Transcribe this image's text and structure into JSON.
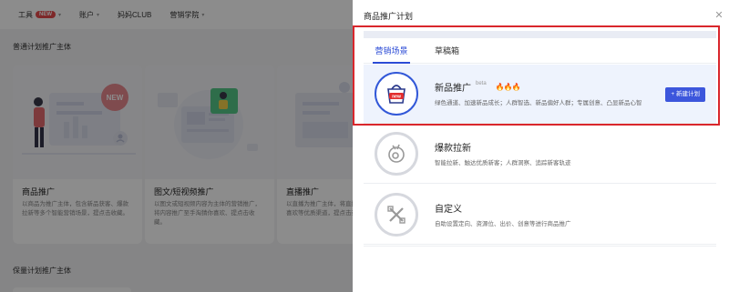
{
  "background": {
    "nav": [
      {
        "label": "工具",
        "badge": "NEW"
      },
      {
        "label": "账户"
      },
      {
        "label": "妈妈CLUB"
      },
      {
        "label": "营销学院"
      }
    ],
    "section_title": "普通计划推广主体",
    "section2_title": "保量计划推广主体",
    "cards": [
      {
        "title": "商品推广",
        "desc": "以商品为推广主体，包含新品获客、爆款拉新等多个智能营销场景，提点击收藏。",
        "badge": "NEW"
      },
      {
        "title": "图文/短视频推广",
        "desc": "以图文或短视频内容为主体的营销推广，将内容推广至手淘猜你喜欢、提点击收藏。"
      },
      {
        "title": "直播推广",
        "desc": "以直播为推广主体，将直播推广场、猜你喜欢等优质渠道，提点击或展示收藏。"
      }
    ]
  },
  "drawer": {
    "title": "商品推广计划",
    "tabs": [
      {
        "label": "营销场景",
        "active": true
      },
      {
        "label": "草稿箱",
        "active": false
      }
    ],
    "scenes": [
      {
        "title": "新品推广",
        "beta": "beta",
        "fire": "🔥🔥🔥",
        "desc": "绿色通道、加速新品成长；人群智选、新品偏好人群；专属创意、凸显新品心智",
        "icon_badge": "new",
        "button": "+ 新建计划"
      },
      {
        "title": "爆款拉新",
        "desc": "智能拉新、触达优质新客；人群洞察、追踪新客轨迹"
      },
      {
        "title": "自定义",
        "desc": "自助设置定向、资源位、出价、创意等进行商品推广"
      }
    ]
  },
  "colors": {
    "accent": "#2b4bd6",
    "highlight": "#d9262c",
    "button": "#3c56dc",
    "fire": "#e3391c"
  }
}
